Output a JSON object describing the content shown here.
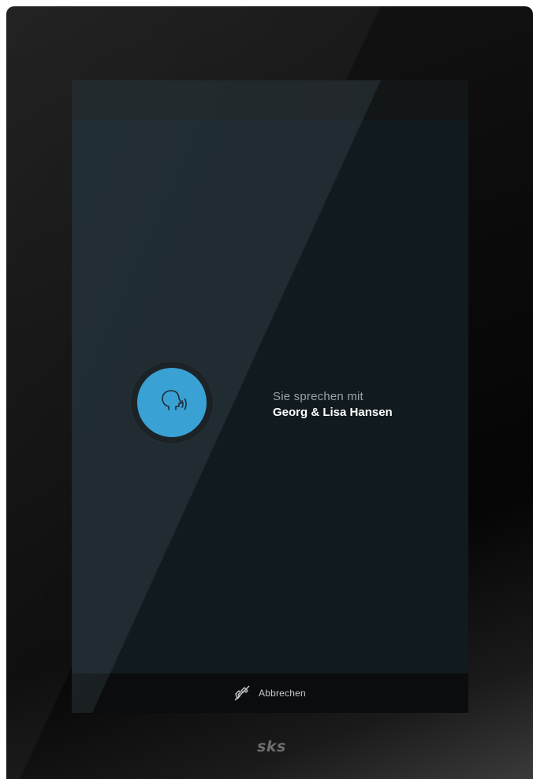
{
  "call": {
    "subtitle": "Sie sprechen mit",
    "contact_name": "Georg & Lisa Hansen",
    "indicator_icon": "speaking-head-icon",
    "indicator_color": "#2fa3dd"
  },
  "action_bar": {
    "cancel_label": "Abbrechen",
    "cancel_icon": "hang-up-icon"
  },
  "device": {
    "brand": "sks"
  }
}
